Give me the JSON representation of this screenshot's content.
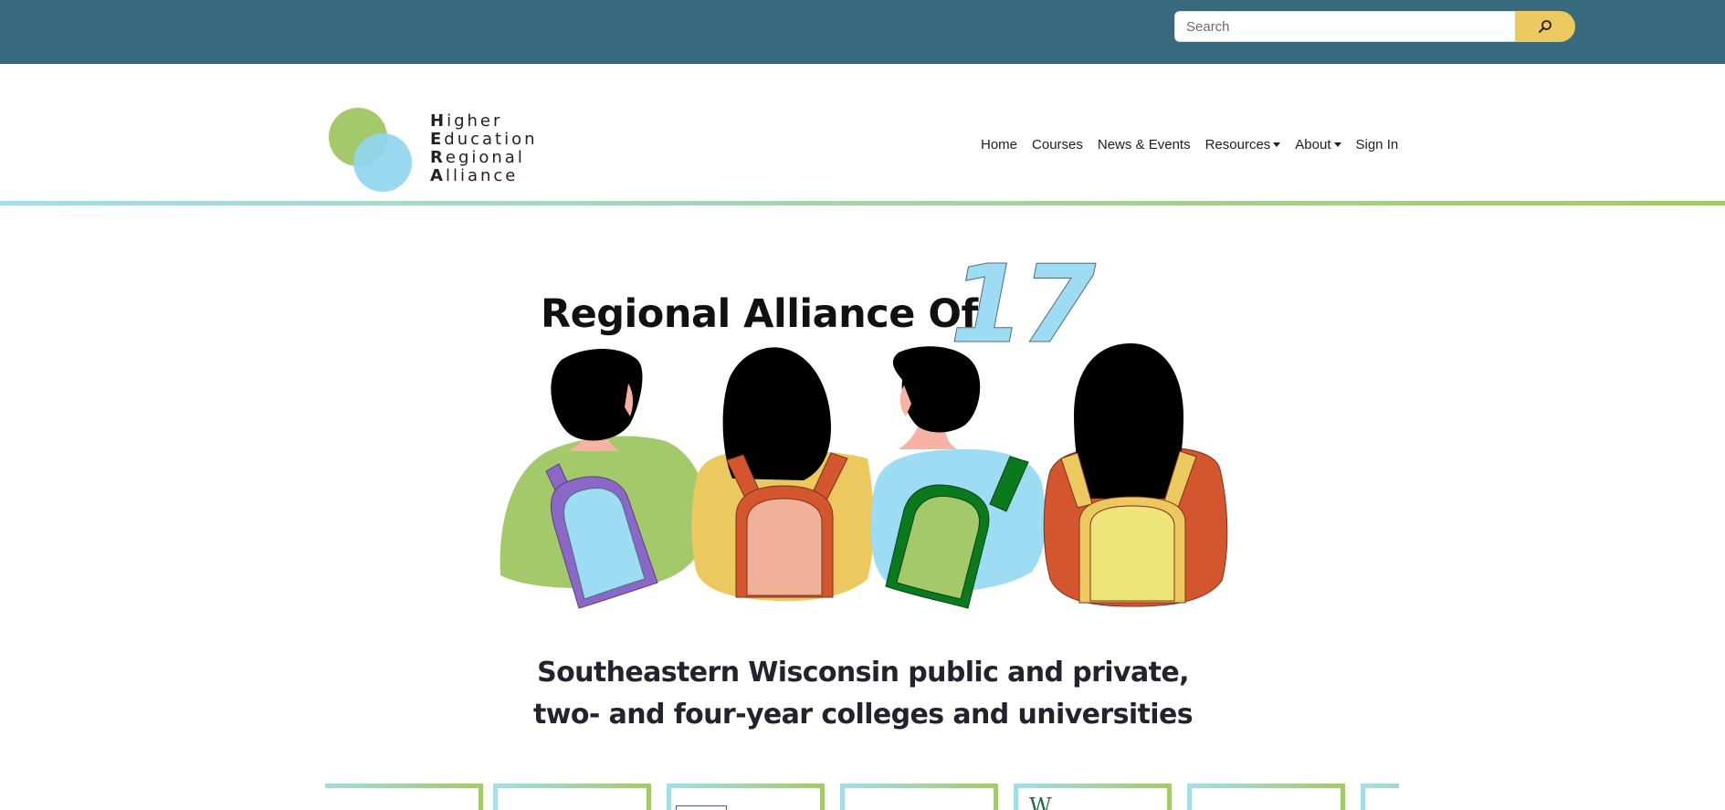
{
  "search": {
    "placeholder": "Search",
    "button_icon": "search-icon"
  },
  "logo": {
    "lines": [
      {
        "initial": "H",
        "rest": "igher"
      },
      {
        "initial": "E",
        "rest": "ducation"
      },
      {
        "initial": "R",
        "rest": "egional"
      },
      {
        "initial": "A",
        "rest": "lliance"
      }
    ],
    "colors": {
      "green": "#a4c96a",
      "blue": "#8fd6ef"
    }
  },
  "nav": {
    "items": [
      {
        "label": "Home",
        "dropdown": false
      },
      {
        "label": "Courses",
        "dropdown": false
      },
      {
        "label": "News & Events",
        "dropdown": false
      },
      {
        "label": "Resources",
        "dropdown": true
      },
      {
        "label": "About",
        "dropdown": true
      },
      {
        "label": "Sign In",
        "dropdown": false
      }
    ]
  },
  "hero": {
    "title": "Regional Alliance Of",
    "number": "17",
    "subtitle_line1": "Southeastern Wisconsin public and private,",
    "subtitle_line2": "two- and four-year colleges and universities"
  },
  "cards": {
    "count": 7,
    "visible_glyph": "W"
  },
  "colors": {
    "topbar": "#366a7c",
    "search_button": "#ecc95e",
    "accent_blue": "#a6dce8",
    "accent_green": "#a4c96a"
  }
}
